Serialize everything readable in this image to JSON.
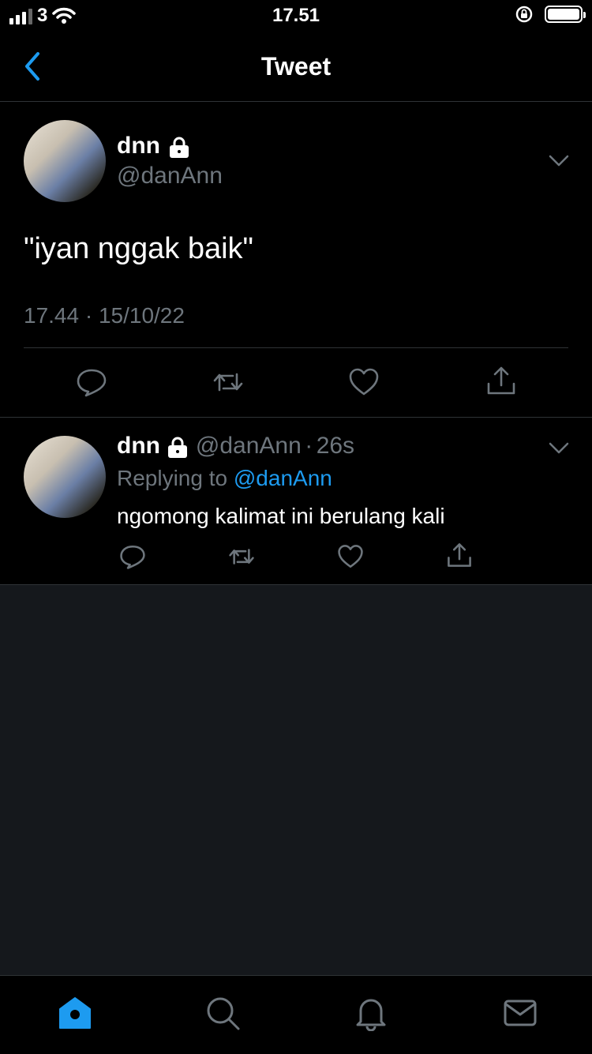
{
  "status_bar": {
    "carrier": "3",
    "time": "17.51"
  },
  "nav": {
    "title": "Tweet"
  },
  "tweet": {
    "author_name": "dnn",
    "author_handle": "@danAnn",
    "text": "\"iyan nggak baik\"",
    "timestamp": "17.44 · 15/10/22"
  },
  "reply": {
    "author_name": "dnn",
    "author_handle": "@danAnn",
    "time_ago": "26s",
    "replying_prefix": "Replying to ",
    "replying_handle": "@danAnn",
    "text": "ngomong kalimat ini berulang kali"
  },
  "colors": {
    "accent": "#1d9bf0",
    "muted": "#6e767d",
    "divider": "#2f3336",
    "empty_bg": "#15181c"
  },
  "icons": {
    "actions": [
      "reply-icon",
      "retweet-icon",
      "like-icon",
      "share-icon"
    ],
    "tabs": [
      "home-icon",
      "search-icon",
      "notifications-icon",
      "messages-icon"
    ]
  }
}
